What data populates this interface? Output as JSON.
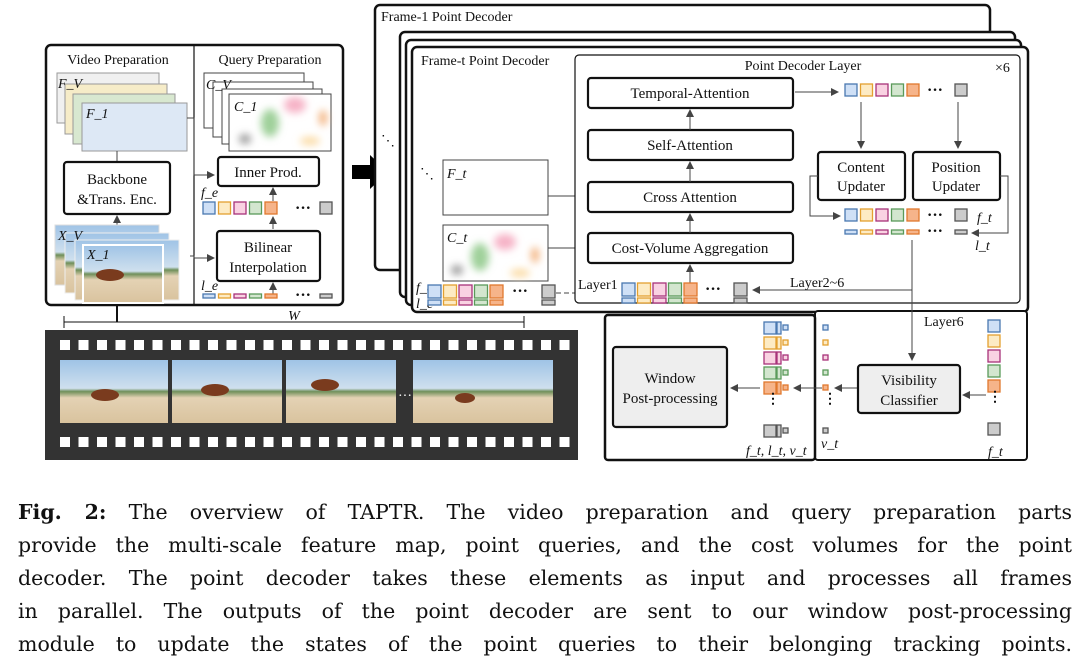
{
  "left_panel": {
    "video_title": "Video Preparation",
    "query_title": "Query Preparation",
    "feature_labels": {
      "last": "F_V",
      "first": "F_1"
    },
    "frame_labels": {
      "last": "X_V",
      "first": "X_1"
    },
    "cost_labels": {
      "last": "C_V",
      "first": "C_1"
    },
    "backbone": [
      "Backbone",
      "&Trans. Enc."
    ],
    "inner_prod": "Inner Prod.",
    "bilinear": [
      "Bilinear",
      "Interpolation"
    ],
    "fe": "f_e",
    "le": "l_e",
    "ellipsis": "···"
  },
  "film": {
    "window_label": "W",
    "ellipsis": "···"
  },
  "decoder": {
    "frame1_title": "Frame-1 Point Decoder",
    "framet_title": "Frame-t Point Decoder",
    "layer_title": "Point Decoder Layer",
    "repeat": "×6",
    "temporal": "Temporal-Attention",
    "self": "Self-Attention",
    "cross": "Cross Attention",
    "cost": "Cost-Volume Aggregation",
    "content_updater": [
      "Content",
      "Updater"
    ],
    "position_updater": [
      "Position",
      "Updater"
    ],
    "ft_label": "F_t",
    "ct_label": "C_t",
    "layer1": "Layer1",
    "layer2_6": "Layer2~6",
    "layer6": "Layer6",
    "ft": "f_t",
    "lt": "l_t"
  },
  "post": {
    "window": [
      "Window",
      "Post-processing"
    ],
    "visibility": [
      "Visibility",
      "Classifier"
    ],
    "outputs": "f_t, l_t, v_t",
    "vt": "v_t",
    "ft": "f_t"
  },
  "caption": {
    "fig": "Fig. 2:",
    "lines": [
      " The overview of TAPTR. The video preparation and query preparation parts",
      "provide the multi-scale feature map, point queries, and the cost volumes for the point",
      "decoder. The point decoder takes these elements as input and processes all frames",
      "in parallel. The outputs of the point decoder are sent to our window post-processing",
      "module to update the states of the point queries to their belonging tracking points."
    ]
  },
  "token_colors": [
    {
      "fill": "#cfe0f6",
      "stroke": "#4a78b0"
    },
    {
      "fill": "#fdebc4",
      "stroke": "#e3a030"
    },
    {
      "fill": "#f9d2e2",
      "stroke": "#a8327a"
    },
    {
      "fill": "#d3e6cf",
      "stroke": "#5a9a5a"
    },
    {
      "fill": "#f6b48a",
      "stroke": "#e0782e"
    }
  ],
  "gray_token": {
    "fill": "#cccccc",
    "stroke": "#555555"
  },
  "arrow_color": "#444444"
}
